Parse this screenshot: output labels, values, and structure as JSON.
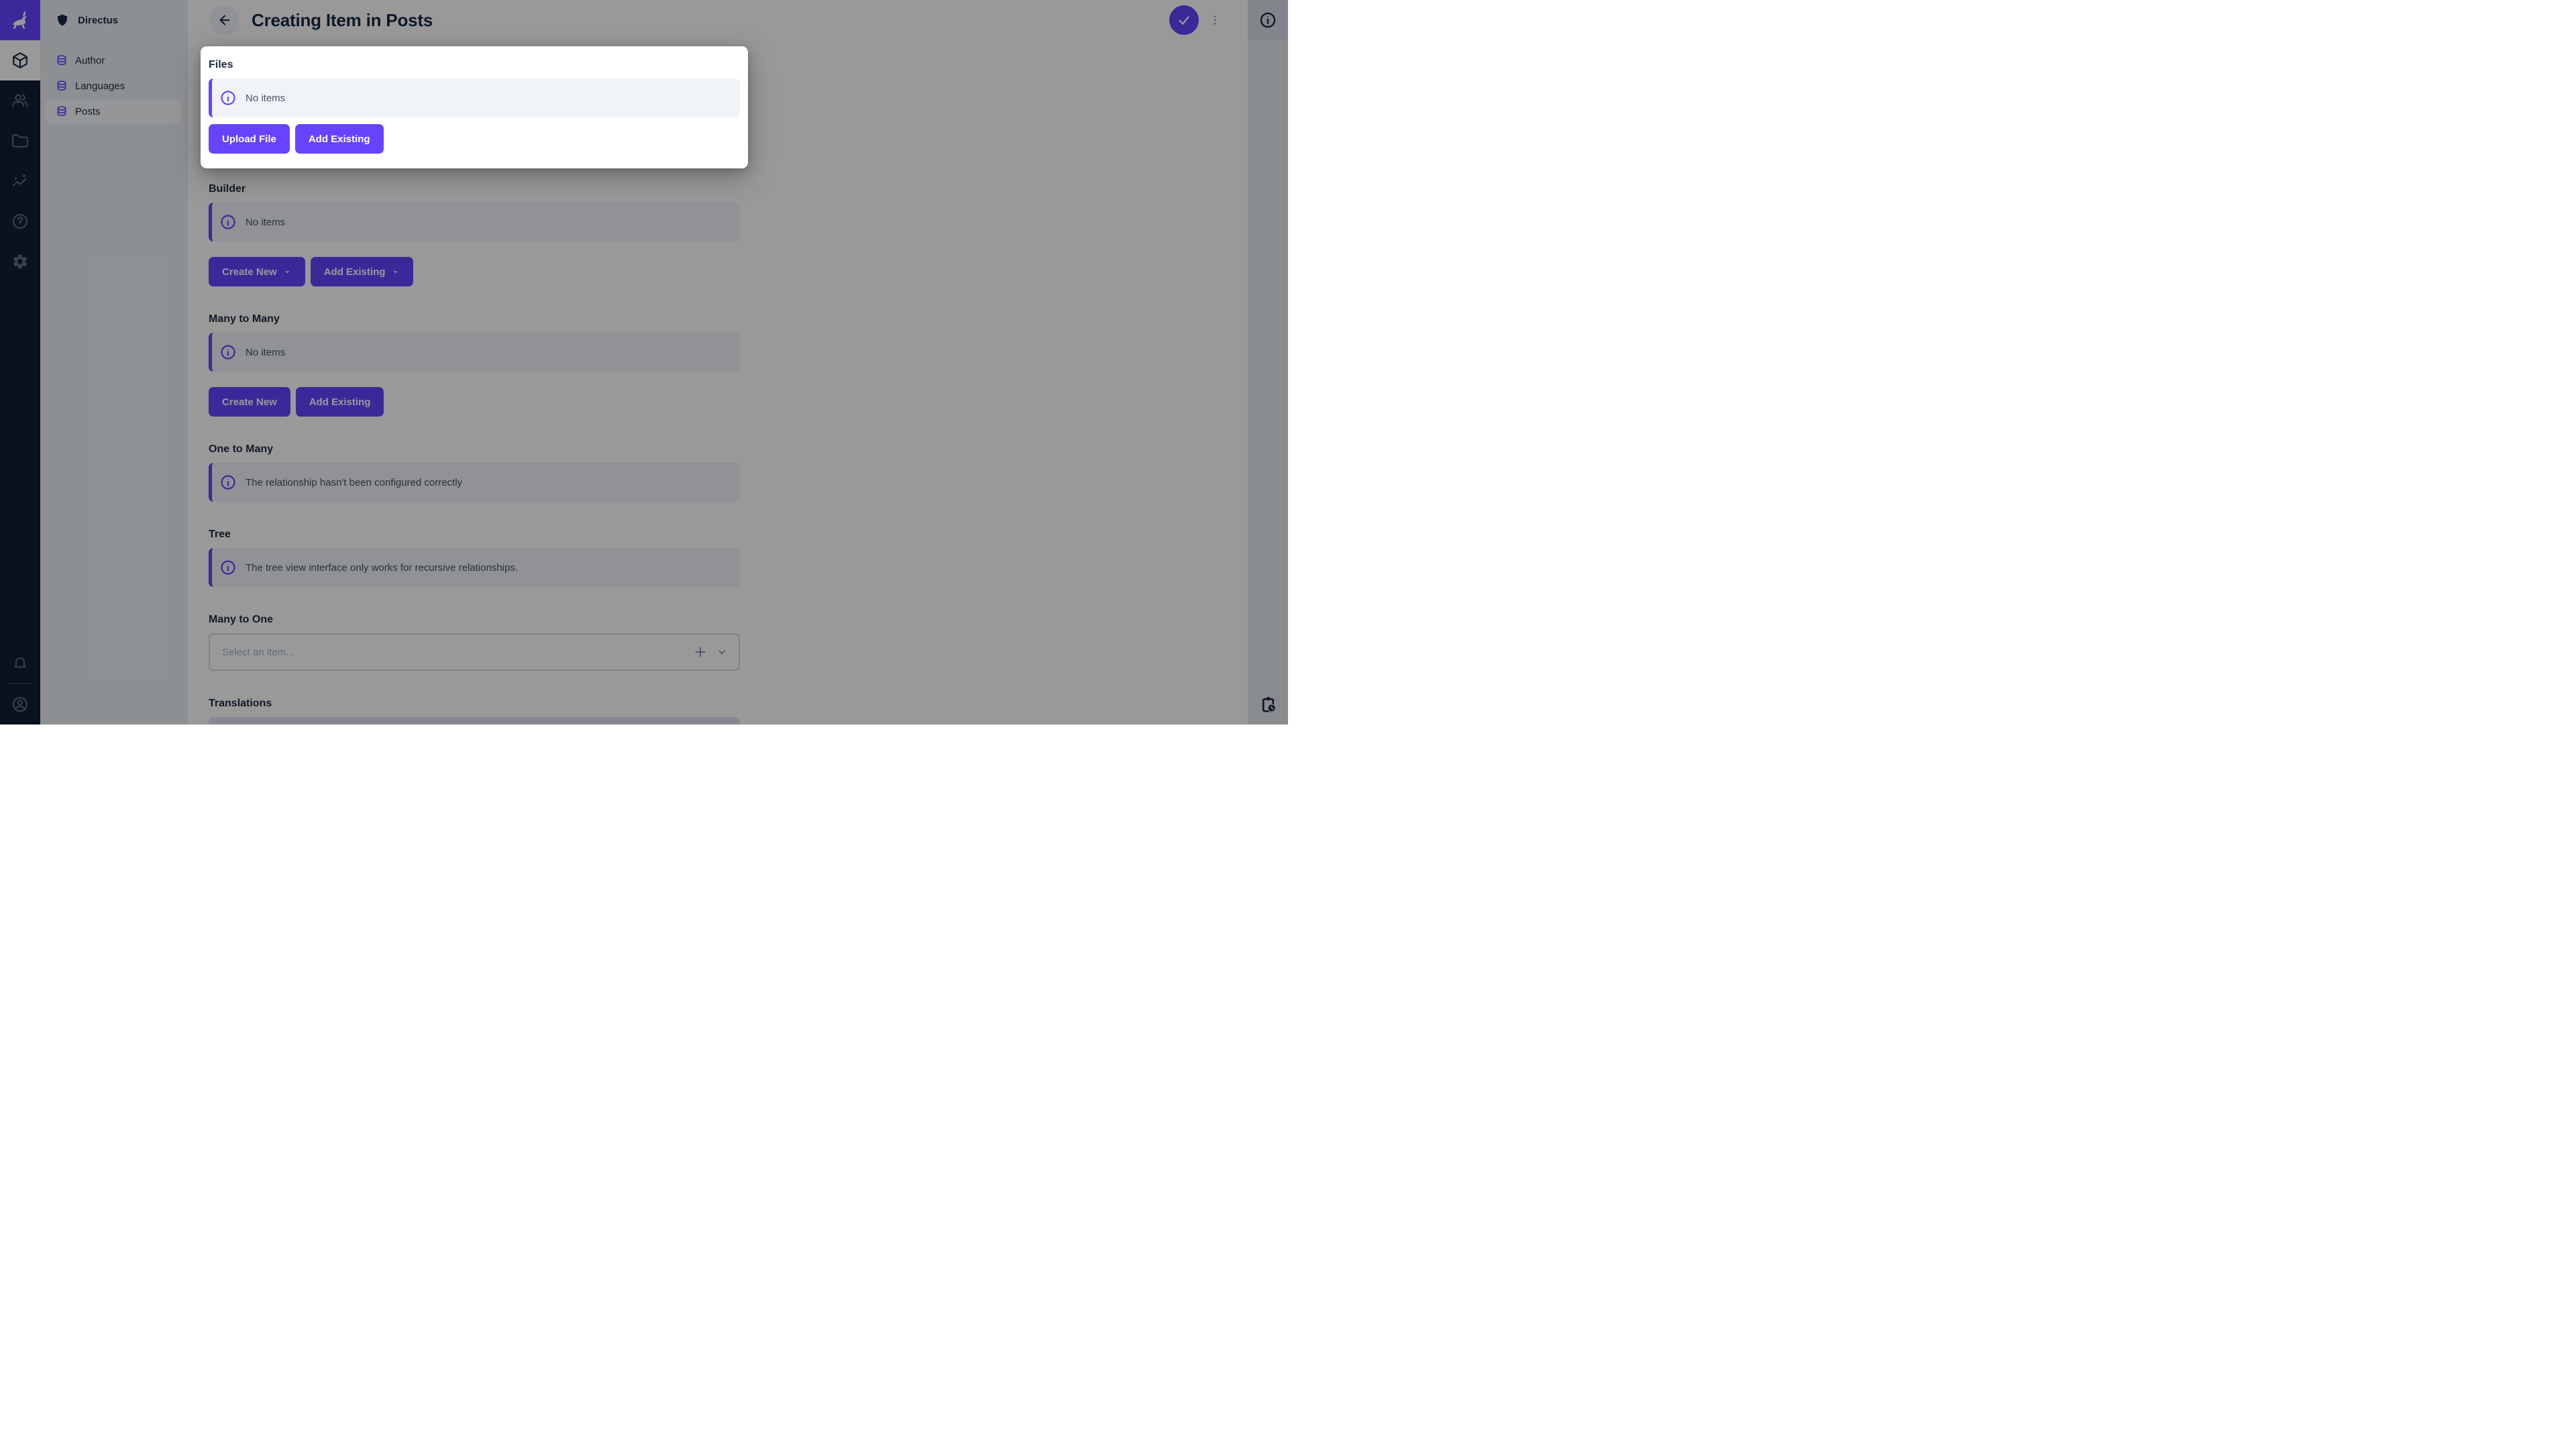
{
  "app": {
    "project_name": "Directus"
  },
  "module_bar": {
    "modules": [
      {
        "id": "content",
        "icon": "cube-icon",
        "active": true
      },
      {
        "id": "users",
        "icon": "users-icon",
        "active": false
      },
      {
        "id": "files",
        "icon": "folder-icon",
        "active": false
      },
      {
        "id": "insights",
        "icon": "insights-icon",
        "active": false
      },
      {
        "id": "help",
        "icon": "help-icon",
        "active": false
      },
      {
        "id": "settings",
        "icon": "gear-icon",
        "active": false
      }
    ],
    "bottom": [
      {
        "id": "notifications",
        "icon": "bell-icon"
      },
      {
        "id": "account",
        "icon": "account-circle-icon"
      }
    ]
  },
  "nav": {
    "items": [
      {
        "label": "Author",
        "icon": "database-icon",
        "active": false
      },
      {
        "label": "Languages",
        "icon": "database-icon",
        "active": false
      },
      {
        "label": "Posts",
        "icon": "database-icon",
        "active": true
      }
    ]
  },
  "header": {
    "title": "Creating Item in Posts",
    "back_icon": "arrow-left-icon",
    "save_icon": "check-icon",
    "more_icon": "kebab-menu-icon"
  },
  "right_sidebar": {
    "top_icon": "info-icon",
    "bottom_icon": "clipboard-clock-icon"
  },
  "form": {
    "files": {
      "label": "Files",
      "notice": "No items",
      "buttons": [
        {
          "label": "Upload File"
        },
        {
          "label": "Add Existing"
        }
      ]
    },
    "builder": {
      "label": "Builder",
      "notice": "No items",
      "buttons": [
        {
          "label": "Create New",
          "dropdown": true
        },
        {
          "label": "Add Existing",
          "dropdown": true
        }
      ]
    },
    "many_to_many": {
      "label": "Many to Many",
      "notice": "No items",
      "buttons": [
        {
          "label": "Create New"
        },
        {
          "label": "Add Existing"
        }
      ]
    },
    "one_to_many": {
      "label": "One to Many",
      "notice": "The relationship hasn't been configured correctly"
    },
    "tree": {
      "label": "Tree",
      "notice": "The tree view interface only works for recursive relationships."
    },
    "many_to_one": {
      "label": "Many to One",
      "placeholder": "Select an item..."
    },
    "translations": {
      "label": "Translations"
    }
  },
  "colors": {
    "primary": "#6644FF",
    "module_bar_bg": "#111E35",
    "surface": "#FFFFFF",
    "surface_alt": "#F0F4F9",
    "overlay": "rgba(0,0,0,0.4)"
  }
}
